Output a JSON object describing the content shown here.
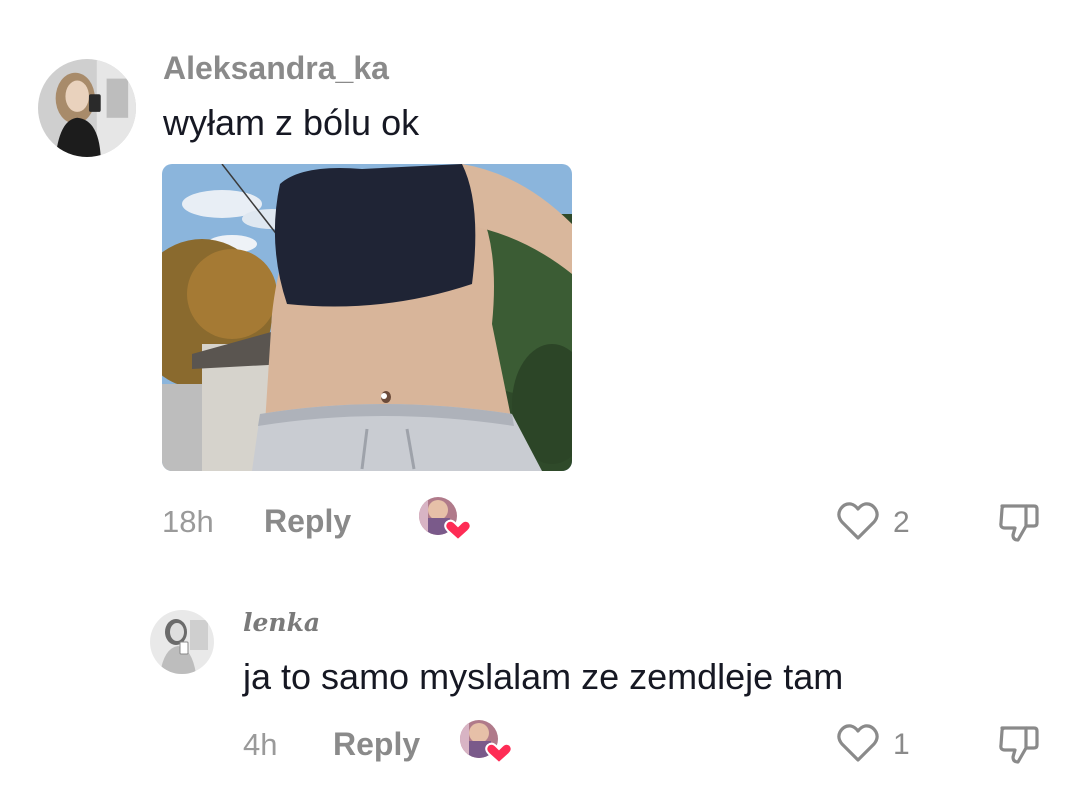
{
  "comments": [
    {
      "username": "Aleksandra_ka",
      "text": "wyłam z bólu ok",
      "time": "18h",
      "reply_label": "Reply",
      "like_count": "2",
      "has_photo": true
    },
    {
      "username": "lenka",
      "text": "ja to samo myslalam ze zemdleje tam",
      "time": "4h",
      "reply_label": "Reply",
      "like_count": "1"
    }
  ],
  "icons": {
    "like": "heart-outline-icon",
    "dislike": "thumbs-down-icon",
    "liked_by_creator": "creator-liked-avatar-icon"
  },
  "colors": {
    "heart_badge": "#fe2c55",
    "text_primary": "#161823",
    "text_secondary": "#8a8a8a"
  }
}
